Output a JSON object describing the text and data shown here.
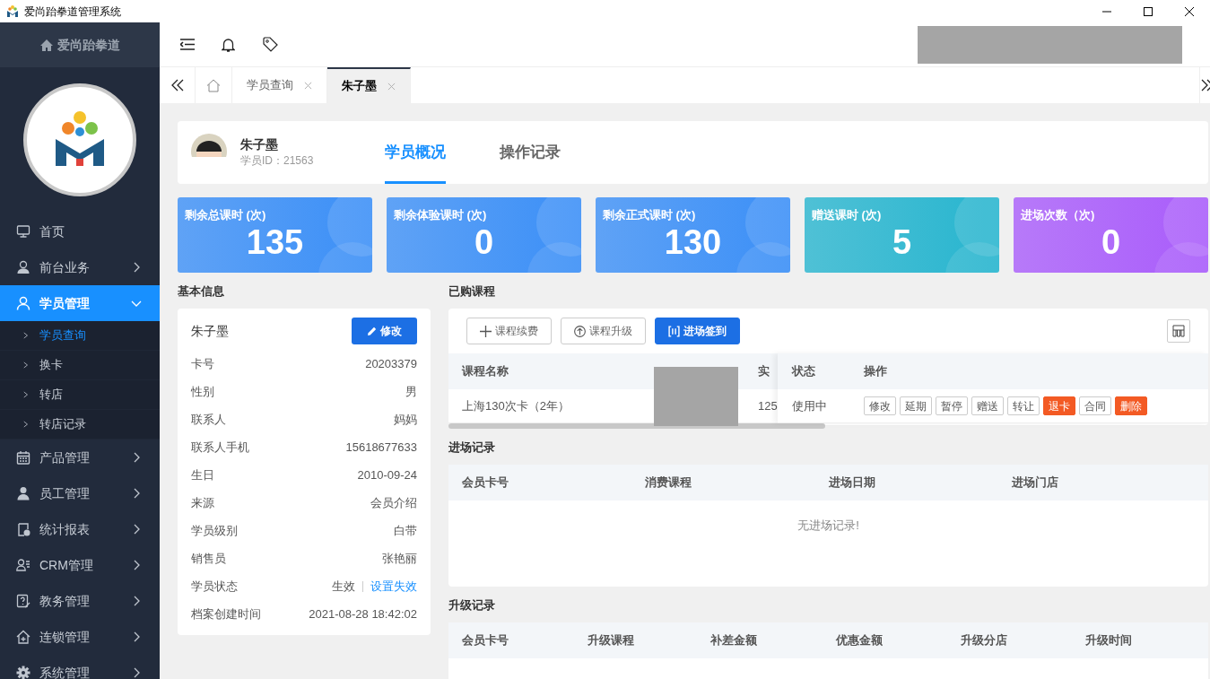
{
  "window": {
    "title": "爱尚跆拳道管理系统"
  },
  "sidebar": {
    "brand": "爱尚跆拳道",
    "items": [
      {
        "label": "首页",
        "selected": false
      },
      {
        "label": "前台业务",
        "selected": false,
        "expanded": false
      },
      {
        "label": "学员管理",
        "selected": true,
        "expanded": true,
        "children": [
          {
            "label": "学员查询",
            "selected": true
          },
          {
            "label": "换卡",
            "selected": false
          },
          {
            "label": "转店",
            "selected": false
          },
          {
            "label": "转店记录",
            "selected": false
          }
        ]
      },
      {
        "label": "产品管理",
        "selected": false,
        "expanded": false
      },
      {
        "label": "员工管理",
        "selected": false,
        "expanded": false
      },
      {
        "label": "统计报表",
        "selected": false,
        "expanded": false
      },
      {
        "label": "CRM管理",
        "selected": false,
        "expanded": false
      },
      {
        "label": "教务管理",
        "selected": false,
        "expanded": false
      },
      {
        "label": "连锁管理",
        "selected": false,
        "expanded": false
      },
      {
        "label": "系统管理",
        "selected": false,
        "expanded": false
      }
    ]
  },
  "tabs": [
    {
      "label": "学员查询",
      "selected": false
    },
    {
      "label": "朱子墨",
      "selected": true
    }
  ],
  "profile": {
    "name": "朱子墨",
    "id_label": "学员ID：21563",
    "tabs": [
      {
        "label": "学员概况",
        "selected": true
      },
      {
        "label": "操作记录",
        "selected": false
      }
    ]
  },
  "stats": [
    {
      "label": "剩余总课时 (次)",
      "value": "135",
      "color": "#3b8ff7"
    },
    {
      "label": "剩余体验课时 (次)",
      "value": "0",
      "color": "#3b8ff7"
    },
    {
      "label": "剩余正式课时 (次)",
      "value": "130",
      "color": "#3b8ff7"
    },
    {
      "label": "赠送课时 (次)",
      "value": "5",
      "color": "#27b5cf"
    },
    {
      "label": "进场次数（次)",
      "value": "0",
      "color": "#a95cfb"
    }
  ],
  "basic_info": {
    "title": "基本信息",
    "name": "朱子墨",
    "edit_button": "修改",
    "fields": [
      {
        "label": "卡号",
        "value": "20203379"
      },
      {
        "label": "性别",
        "value": "男"
      },
      {
        "label": "联系人",
        "value": "妈妈"
      },
      {
        "label": "联系人手机",
        "value": "15618677633"
      },
      {
        "label": "生日",
        "value": "2010-09-24"
      },
      {
        "label": "来源",
        "value": "会员介绍"
      },
      {
        "label": "学员级别",
        "value": "白带"
      },
      {
        "label": "销售员",
        "value": "张艳丽"
      },
      {
        "label": "学员状态",
        "value": "生效",
        "link": "设置失效"
      },
      {
        "label": "档案创建时间",
        "value": "2021-08-28 18:42:02"
      }
    ]
  },
  "purchased": {
    "title": "已购课程",
    "buttons": [
      {
        "label": "课程续费",
        "kind": "outline"
      },
      {
        "label": "课程升级",
        "kind": "outline"
      },
      {
        "label": "进场签到",
        "kind": "primary"
      }
    ],
    "columns": [
      "课程名称",
      "实"
    ],
    "fixed_columns": [
      "状态",
      "操作"
    ],
    "rows": [
      {
        "course": "上海130次卡（2年）",
        "paid": "125",
        "status": "使用中",
        "actions": [
          {
            "label": "修改",
            "kind": "normal"
          },
          {
            "label": "延期",
            "kind": "normal"
          },
          {
            "label": "暂停",
            "kind": "normal"
          },
          {
            "label": "赠送",
            "kind": "normal"
          },
          {
            "label": "转让",
            "kind": "normal"
          },
          {
            "label": "退卡",
            "kind": "danger"
          },
          {
            "label": "合同",
            "kind": "normal"
          },
          {
            "label": "删除",
            "kind": "danger"
          }
        ]
      }
    ]
  },
  "entry_records": {
    "title": "进场记录",
    "columns": [
      "会员卡号",
      "消费课程",
      "进场日期",
      "进场门店"
    ],
    "empty": "无进场记录!"
  },
  "upgrade_records": {
    "title": "升级记录",
    "columns": [
      "会员卡号",
      "升级课程",
      "补差金额",
      "优惠金额",
      "升级分店",
      "升级时间"
    ]
  }
}
